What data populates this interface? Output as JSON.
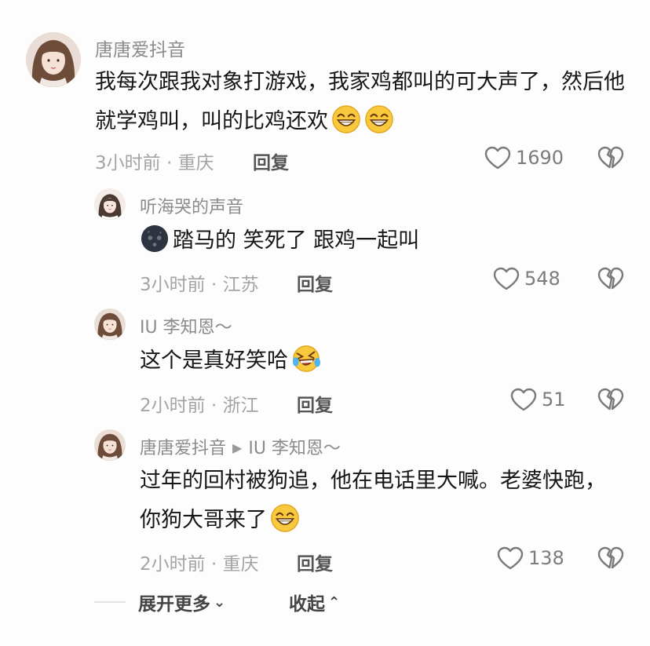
{
  "comments": [
    {
      "author": "唐唐爱抖音",
      "text": "我每次跟我对象打游戏，我家鸡都叫的可大声了，然后他就学鸡叫，叫的比鸡还欢",
      "emojis": [
        "grin-emoji",
        "grin-emoji"
      ],
      "time": "3小时前 · 重庆",
      "reply_label": "回复",
      "likes": "1690"
    }
  ],
  "replies": [
    {
      "author": "听海哭的声音",
      "text": "踏马的 笑死了 跟鸡一起叫",
      "leading_emoji": "dark-face-emoji",
      "time": "3小时前 · 江苏",
      "reply_label": "回复",
      "likes": "548"
    },
    {
      "author": "IU 李知恩～",
      "text": "这个是真好笑哈",
      "trailing_emoji": "rofl-emoji",
      "time": "2小时前 · 浙江",
      "reply_label": "回复",
      "likes": "51"
    },
    {
      "author": "唐唐爱抖音",
      "reply_to": "IU 李知恩～",
      "text": "过年的回村被狗追，他在电话里大喊。老婆快跑，你狗大哥来了",
      "trailing_emoji": "grin-emoji",
      "time": "2小时前 · 重庆",
      "reply_label": "回复",
      "likes": "138"
    }
  ],
  "footer": {
    "expand_label": "展开更多",
    "collapse_label": "收起"
  },
  "colors": {
    "text": "#161616",
    "meta": "#a4a4a4",
    "author": "#8b8b8b",
    "emoji_yellow": "#f7c53b"
  }
}
